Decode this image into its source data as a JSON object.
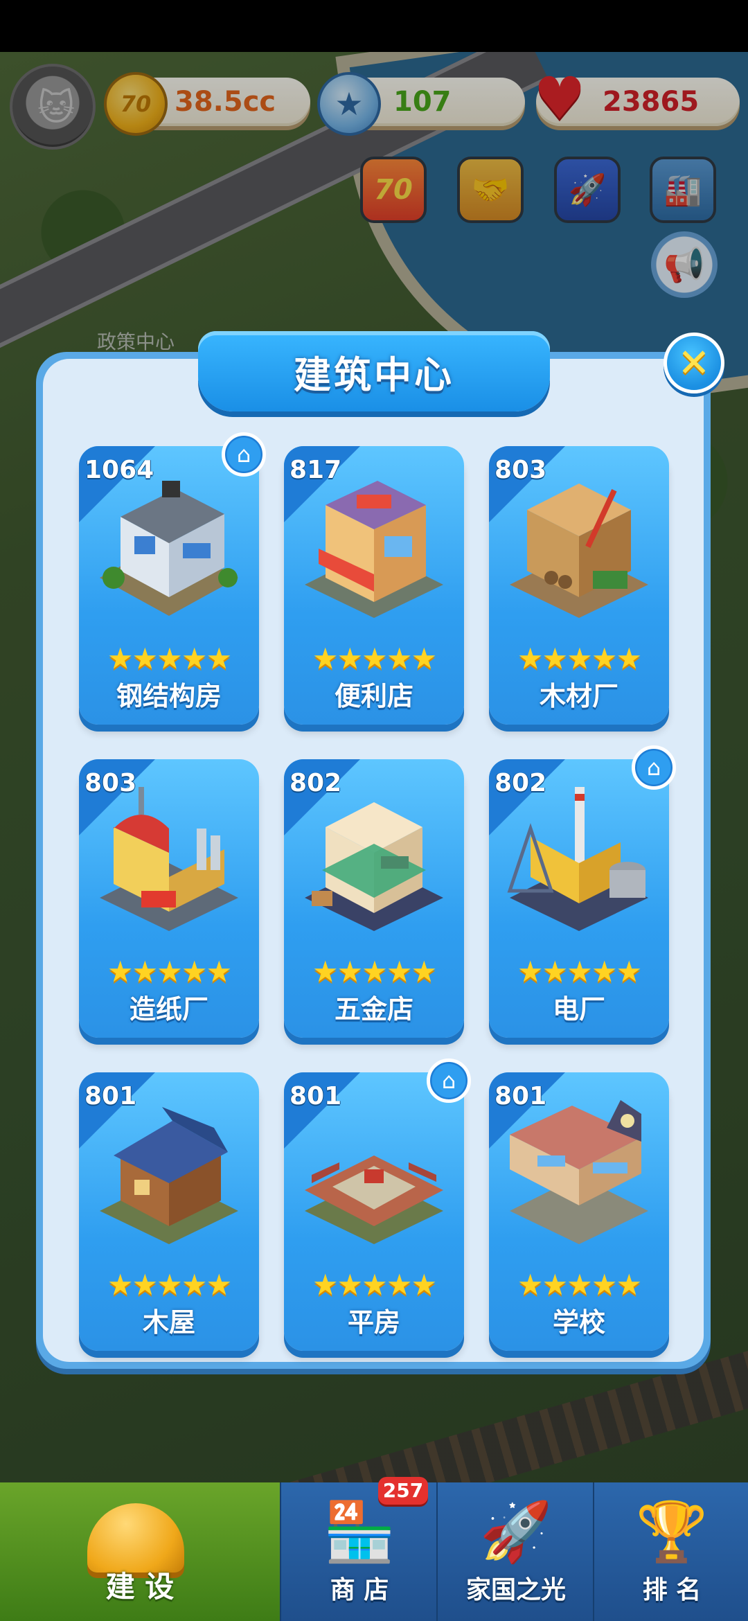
{
  "hud": {
    "coins": "38.5cc",
    "coin_icon_text": "70",
    "stars": "107",
    "hearts": "23865",
    "event_icon_text": "70"
  },
  "map": {
    "label": "政策中心"
  },
  "modal": {
    "title": "建筑中心",
    "close_icon": "close-x-icon"
  },
  "buildings": [
    {
      "score": "1064",
      "name": "钢结构房",
      "stars": 5,
      "home": true
    },
    {
      "score": "817",
      "name": "便利店",
      "stars": 5,
      "home": false
    },
    {
      "score": "803",
      "name": "木材厂",
      "stars": 5,
      "home": false
    },
    {
      "score": "803",
      "name": "造纸厂",
      "stars": 5,
      "home": false
    },
    {
      "score": "802",
      "name": "五金店",
      "stars": 5,
      "home": false
    },
    {
      "score": "802",
      "name": "电厂",
      "stars": 5,
      "home": true
    },
    {
      "score": "801",
      "name": "木屋",
      "stars": 5,
      "home": false
    },
    {
      "score": "801",
      "name": "平房",
      "stars": 5,
      "home": true
    },
    {
      "score": "801",
      "name": "学校",
      "stars": 5,
      "home": false
    }
  ],
  "nav": {
    "build": "建 设",
    "shop": "商 店",
    "shop_badge": "257",
    "home_light": "家国之光",
    "rank": "排 名"
  },
  "colors": {
    "modal_blue": "#5aa9e6",
    "card_blue": "#2f9ef0",
    "star_gold": "#ffd322",
    "nav_active_green": "#6aa52a"
  }
}
